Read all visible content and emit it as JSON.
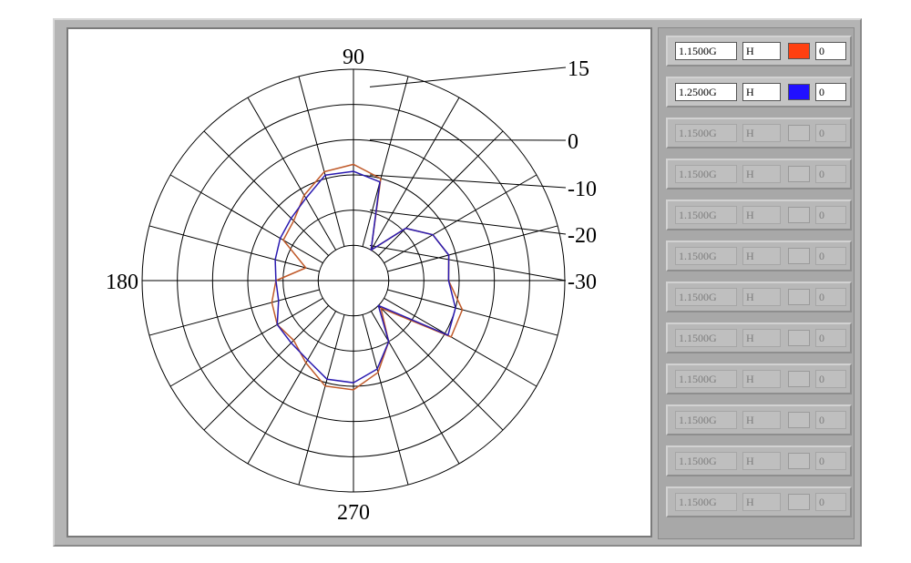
{
  "chart_data": {
    "type": "polar",
    "angle_labels": [
      "90",
      "180",
      "270"
    ],
    "radial_tick_labels": [
      "15",
      "0",
      "-10",
      "-20",
      "-30"
    ],
    "radial_tick_values": [
      15,
      0,
      -10,
      -20,
      -30
    ],
    "radial_range": [
      -40,
      20
    ],
    "grid": true,
    "series": [
      {
        "color": "#c05a2a",
        "angles": [
          0,
          15,
          30,
          45,
          60,
          75,
          90,
          105,
          120,
          135,
          150,
          165,
          180,
          195,
          210,
          225,
          240,
          255,
          270,
          285,
          300,
          315,
          330,
          345
        ],
        "values": [
          -13,
          -12,
          -14,
          -19,
          -30,
          -10,
          -7,
          -8,
          -12,
          -16,
          -17,
          -26,
          -18,
          -16,
          -15,
          -16,
          -13,
          -9,
          -9,
          -13,
          -20,
          -29,
          -8,
          -8
        ]
      },
      {
        "color": "#2a1ab0",
        "angles": [
          0,
          15,
          30,
          45,
          60,
          75,
          90,
          105,
          120,
          135,
          150,
          165,
          180,
          195,
          210,
          225,
          240,
          255,
          270,
          285,
          300,
          315,
          330,
          345
        ],
        "values": [
          -13,
          -12,
          -14,
          -19,
          -30,
          -11,
          -9,
          -9,
          -13,
          -15,
          -16,
          -17,
          -18,
          -18,
          -15,
          -15,
          -14,
          -11,
          -11,
          -14,
          -20,
          -30,
          -9,
          -10
        ]
      }
    ]
  },
  "legend_panel": {
    "rows": [
      {
        "freq": "1.1500G",
        "pol": "H",
        "color": "#ff4010",
        "value": "0",
        "active": true
      },
      {
        "freq": "1.2500G",
        "pol": "H",
        "color": "#2010ff",
        "value": "0",
        "active": true
      },
      {
        "freq": "1.1500G",
        "pol": "H",
        "color": "",
        "value": "0",
        "active": false
      },
      {
        "freq": "1.1500G",
        "pol": "H",
        "color": "",
        "value": "0",
        "active": false
      },
      {
        "freq": "1.1500G",
        "pol": "H",
        "color": "",
        "value": "0",
        "active": false
      },
      {
        "freq": "1.1500G",
        "pol": "H",
        "color": "",
        "value": "0",
        "active": false
      },
      {
        "freq": "1.1500G",
        "pol": "H",
        "color": "",
        "value": "0",
        "active": false
      },
      {
        "freq": "1.1500G",
        "pol": "H",
        "color": "",
        "value": "0",
        "active": false
      },
      {
        "freq": "1.1500G",
        "pol": "H",
        "color": "",
        "value": "0",
        "active": false
      },
      {
        "freq": "1.1500G",
        "pol": "H",
        "color": "",
        "value": "0",
        "active": false
      },
      {
        "freq": "1.1500G",
        "pol": "H",
        "color": "",
        "value": "0",
        "active": false
      },
      {
        "freq": "1.1500G",
        "pol": "H",
        "color": "",
        "value": "0",
        "active": false
      }
    ]
  }
}
